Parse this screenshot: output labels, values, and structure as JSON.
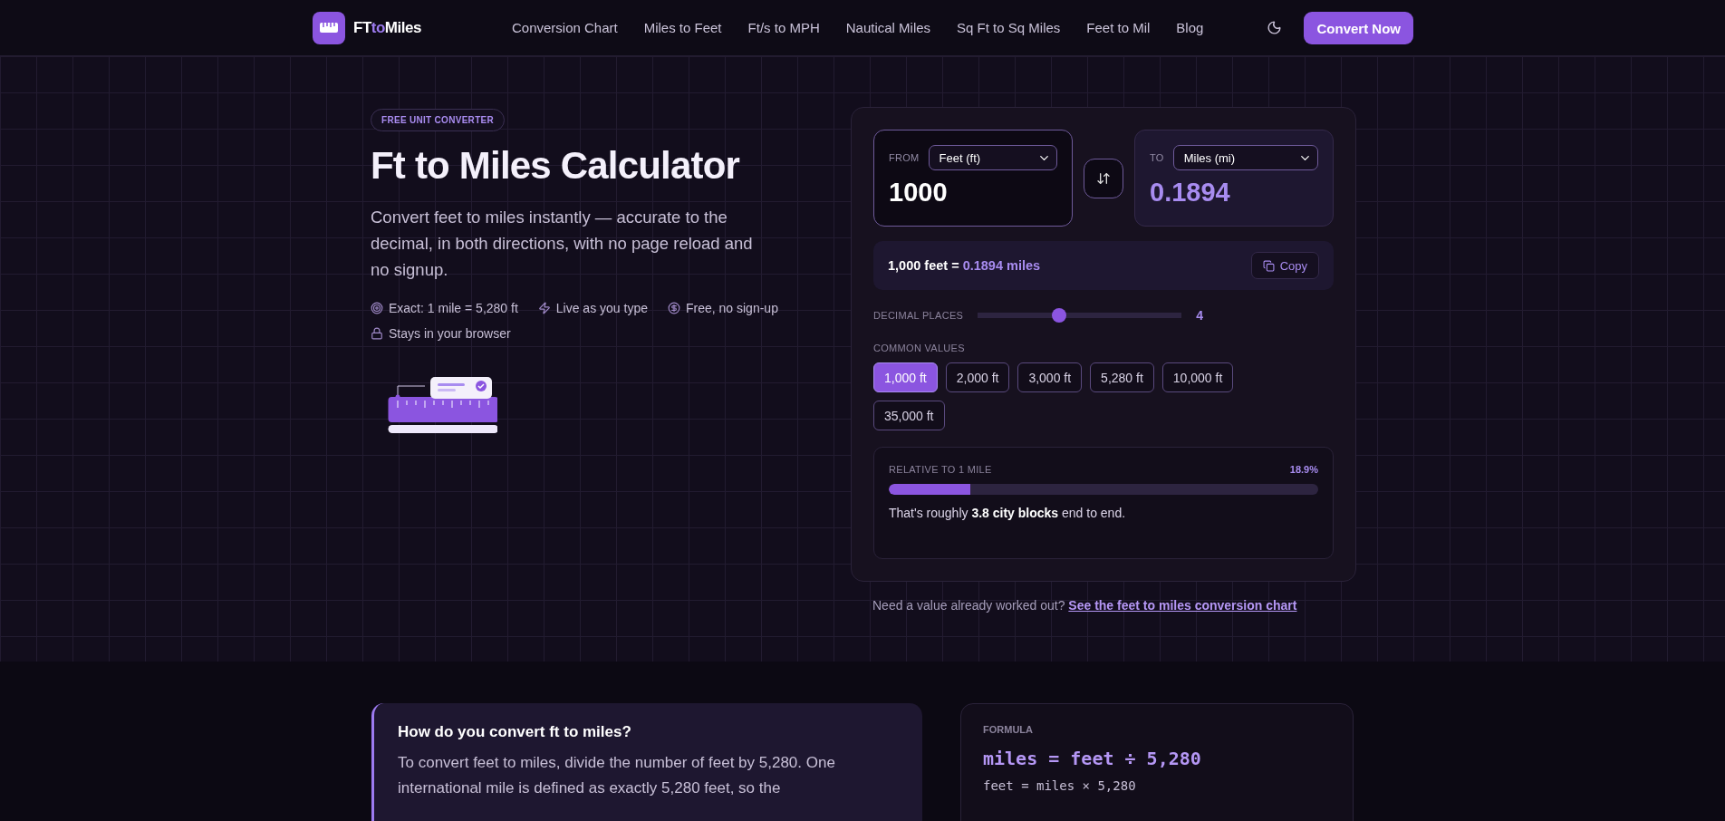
{
  "header": {
    "logo": {
      "first": "FT",
      "middle": "to",
      "last": "Miles"
    },
    "nav": [
      "Conversion Chart",
      "Miles to Feet",
      "Ft/s to MPH",
      "Nautical Miles",
      "Sq Ft to Sq Miles",
      "Feet to Mil",
      "Blog"
    ],
    "cta": "Convert Now"
  },
  "hero": {
    "badge": "FREE UNIT CONVERTER",
    "title": "Ft to Miles Calculator",
    "description": "Convert feet to miles instantly — accurate to the decimal, in both directions, with no page reload and no signup.",
    "features": [
      {
        "kind": "target",
        "text": "Exact: 1 mile = 5,280 ft"
      },
      {
        "kind": "bolt",
        "text": "Live as you type"
      },
      {
        "kind": "coin",
        "text": "Free, no sign-up"
      },
      {
        "kind": "lock",
        "text": "Stays in your browser"
      }
    ]
  },
  "converter": {
    "from": {
      "label": "FROM",
      "unit": "Feet (ft)",
      "value": "1000"
    },
    "to": {
      "label": "TO",
      "unit": "Miles (mi)",
      "value": "0.1894"
    },
    "result": {
      "left": "1,000 feet =",
      "right": "0.1894 miles"
    },
    "copy": "Copy",
    "decimals": {
      "label": "DECIMAL PLACES",
      "level": 0.4,
      "reading": "4"
    },
    "common": {
      "label": "COMMON VALUES",
      "items": [
        {
          "label": "1,000 ft",
          "selected": true
        },
        {
          "label": "2,000 ft",
          "selected": false
        },
        {
          "label": "3,000 ft",
          "selected": false
        },
        {
          "label": "5,280 ft",
          "selected": false
        },
        {
          "label": "10,000 ft",
          "selected": false
        },
        {
          "label": "35,000 ft",
          "selected": false
        }
      ]
    },
    "relative": {
      "label": "RELATIVE TO 1 MILE",
      "reading": "18.9%",
      "level": 0.189,
      "note": "That's roughly **3.8 city blocks** end to end."
    }
  },
  "footnote": {
    "text": "Need a value already worked out?",
    "link": "See the feet to miles conversion chart"
  },
  "explain": {
    "title": "How do you convert ft to miles?",
    "text": "To convert feet to miles, divide the number of feet by 5,280. One international mile is defined as exactly 5,280 feet, so the"
  },
  "formula": {
    "label": "FORMULA",
    "main": "miles = feet ÷ 5,280",
    "inverse": "feet = miles × 5,280"
  }
}
